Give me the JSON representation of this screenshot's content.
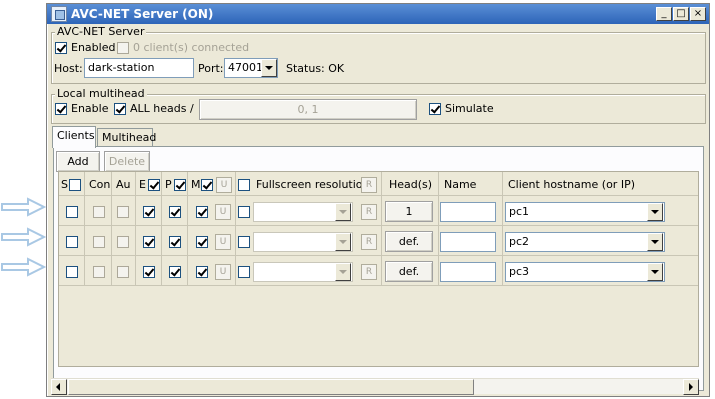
{
  "window": {
    "title": "AVC-NET Server (ON)",
    "minimize_glyph": "_",
    "maximize_glyph": "□",
    "close_glyph": "×"
  },
  "server": {
    "group_title": "AVC-NET Server",
    "enabled_label": "Enabled",
    "enabled_checked": true,
    "clients_connected_label": "0 client(s) connected",
    "host_label": "Host:",
    "host_value": "dark-station",
    "port_label": "Port:",
    "port_value": "47001",
    "status_text": "Status: OK"
  },
  "multihead": {
    "group_title": "Local multihead",
    "enable_label": "Enable",
    "enable_checked": true,
    "all_heads_label": "ALL heads /",
    "all_heads_checked": true,
    "heads_value": "0, 1",
    "simulate_label": "Simulate",
    "simulate_checked": true
  },
  "tabs": [
    {
      "label": "Clients",
      "active": true
    },
    {
      "label": "Multihead",
      "active": false
    }
  ],
  "toolbar": {
    "add_label": "Add",
    "delete_label": "Delete"
  },
  "columns": {
    "s": "S",
    "con": "Con",
    "au": "Au",
    "e": "E",
    "p": "P",
    "m": "M",
    "u": "U",
    "fullscreen": "Fullscreen resolution",
    "r": "R",
    "heads": "Head(s)",
    "name": "Name",
    "hostname": "Client hostname (or IP)"
  },
  "rows": [
    {
      "heads_button": "1",
      "name": "",
      "hostname": "pc1",
      "fullscreen": ""
    },
    {
      "heads_button": "def.",
      "name": "",
      "hostname": "pc2",
      "fullscreen": ""
    },
    {
      "heads_button": "def.",
      "name": "",
      "hostname": "pc3",
      "fullscreen": ""
    }
  ],
  "icons": {
    "app": "app-icon",
    "row_pointer": "arrow-right-icon",
    "dropdown": "chevron-down-icon"
  },
  "colors": {
    "titlebar_start": "#5a8fd6",
    "titlebar_end": "#2d64b8",
    "window_bg": "#ece9d8",
    "arrow_pointer": "#a9c8e4"
  }
}
